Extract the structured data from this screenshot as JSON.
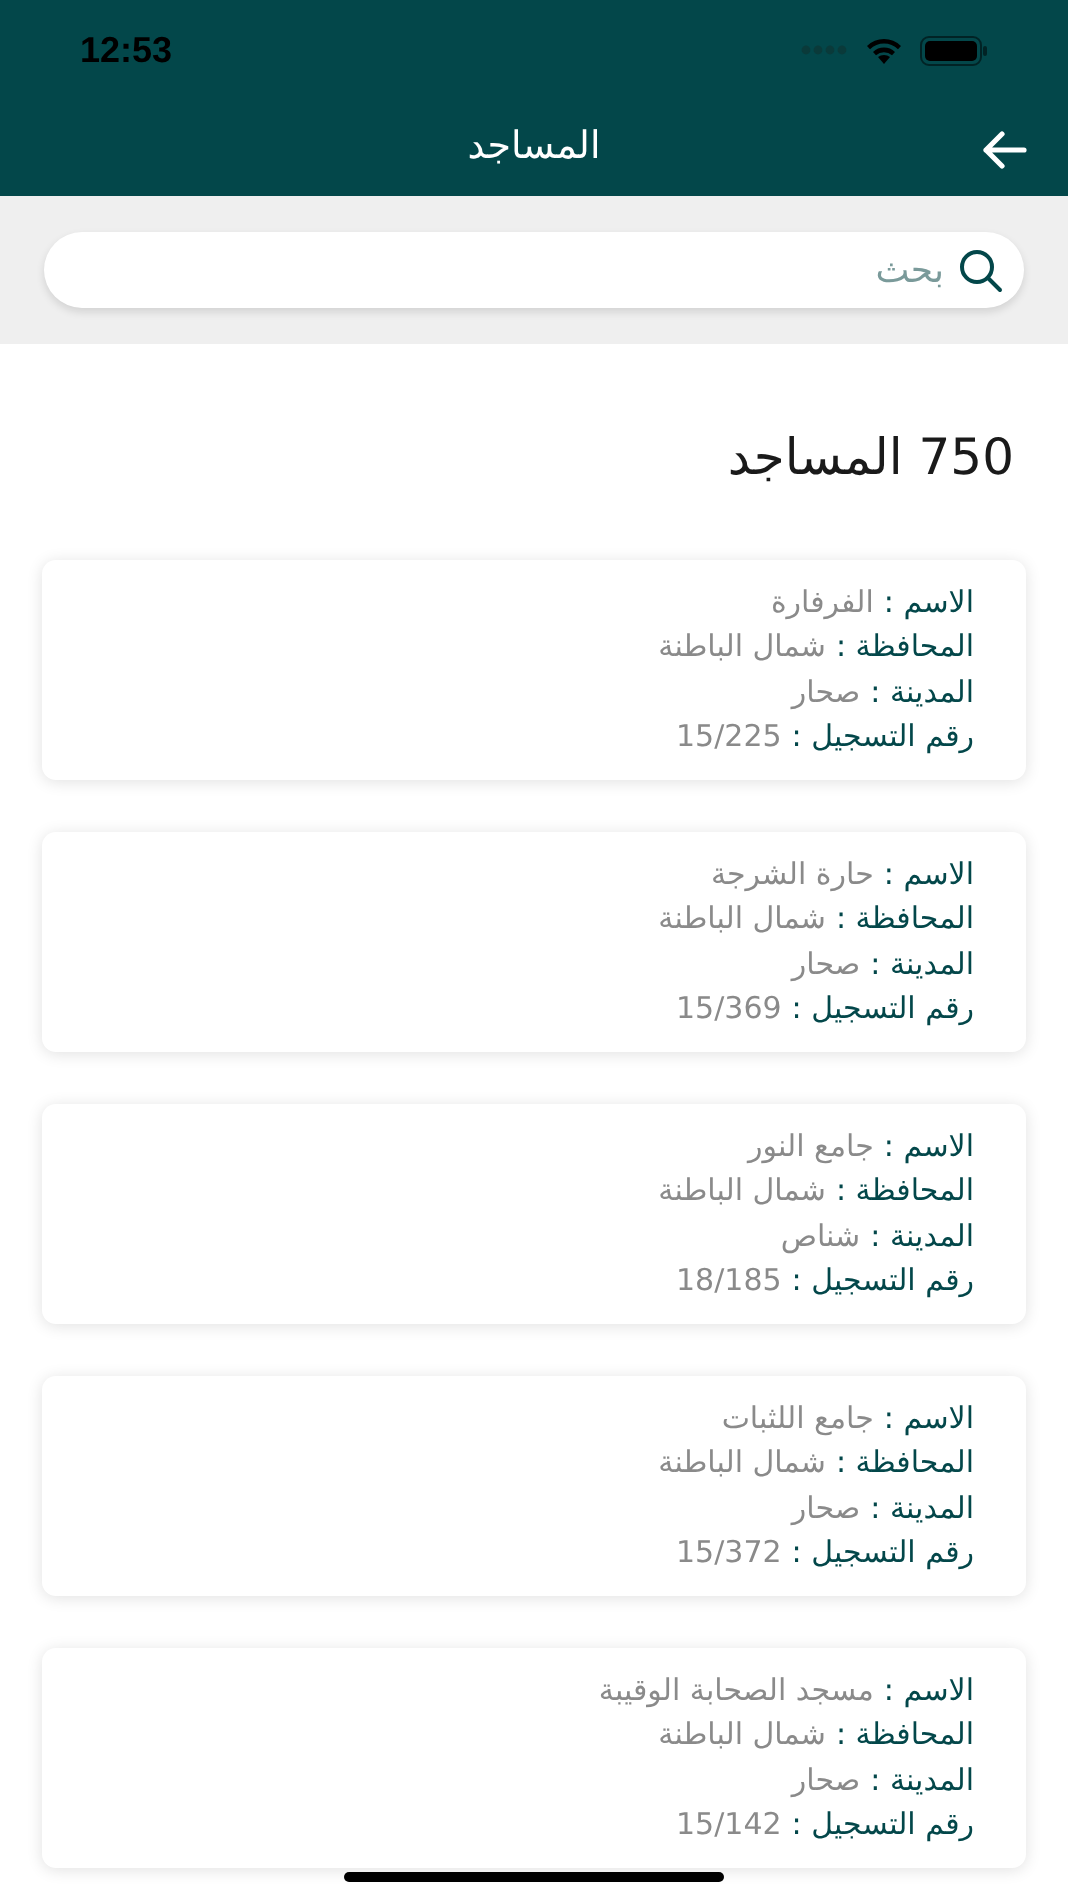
{
  "status_bar": {
    "time": "12:53"
  },
  "header": {
    "title": "المساجد"
  },
  "search": {
    "placeholder": "بحث"
  },
  "count_title": "750 المساجد",
  "mosques": [
    {
      "fields": [
        {
          "label": "الاسم :",
          "value": "الفرفارة"
        },
        {
          "label": "المحافظة :",
          "value": "شمال الباطنة"
        },
        {
          "label": "المدينة :",
          "value": "صحار"
        },
        {
          "label": "رقم التسجيل :",
          "value": "15/225"
        }
      ]
    },
    {
      "fields": [
        {
          "label": "الاسم :",
          "value": "حارة الشرجة"
        },
        {
          "label": "المحافظة :",
          "value": "شمال الباطنة"
        },
        {
          "label": "المدينة :",
          "value": "صحار"
        },
        {
          "label": "رقم التسجيل :",
          "value": "15/369"
        }
      ]
    },
    {
      "fields": [
        {
          "label": "الاسم :",
          "value": "جامع النور"
        },
        {
          "label": "المحافظة :",
          "value": "شمال الباطنة"
        },
        {
          "label": "المدينة :",
          "value": "شناص"
        },
        {
          "label": "رقم التسجيل :",
          "value": "18/185"
        }
      ]
    },
    {
      "fields": [
        {
          "label": "الاسم :",
          "value": "جامع اللثبات"
        },
        {
          "label": "المحافظة :",
          "value": "شمال الباطنة"
        },
        {
          "label": "المدينة :",
          "value": "صحار"
        },
        {
          "label": "رقم التسجيل :",
          "value": "15/372"
        }
      ]
    },
    {
      "fields": [
        {
          "label": "الاسم :",
          "value": "مسجد الصحابة الوقيبة"
        },
        {
          "label": "المحافظة :",
          "value": "شمال الباطنة"
        },
        {
          "label": "المدينة :",
          "value": "صحار"
        },
        {
          "label": "رقم التسجيل :",
          "value": "15/142"
        }
      ]
    }
  ]
}
